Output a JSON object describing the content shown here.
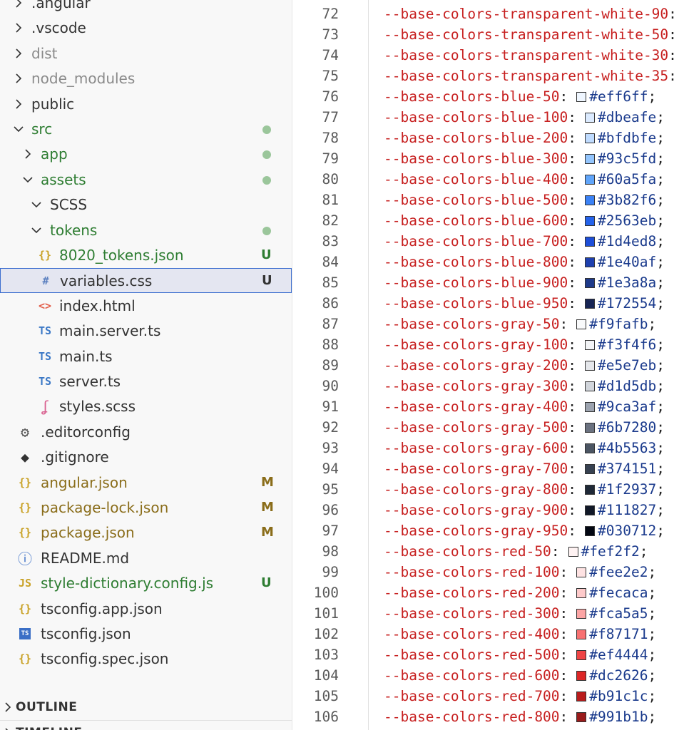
{
  "explorer": {
    "items": [
      {
        "label": ".angular",
        "type": "folder",
        "depth": 0,
        "state": "collapsed",
        "icon": "chevron-right-icon",
        "color": "#333333"
      },
      {
        "label": ".vscode",
        "type": "folder",
        "depth": 0,
        "state": "collapsed",
        "icon": "chevron-right-icon",
        "color": "#333333"
      },
      {
        "label": "dist",
        "type": "folder",
        "depth": 0,
        "state": "collapsed",
        "icon": "chevron-right-icon",
        "color": "#8a8a8a"
      },
      {
        "label": "node_modules",
        "type": "folder",
        "depth": 0,
        "state": "collapsed",
        "icon": "chevron-right-icon",
        "color": "#8a8a8a"
      },
      {
        "label": "public",
        "type": "folder",
        "depth": 0,
        "state": "collapsed",
        "icon": "chevron-right-icon",
        "color": "#333333"
      },
      {
        "label": "src",
        "type": "folder",
        "depth": 0,
        "state": "expanded",
        "icon": "chevron-down-icon",
        "color": "#2e7d32",
        "dot": true
      },
      {
        "label": "app",
        "type": "folder",
        "depth": 1,
        "state": "collapsed",
        "icon": "chevron-right-icon",
        "color": "#2e7d32",
        "dot": true
      },
      {
        "label": "assets",
        "type": "folder",
        "depth": 1,
        "state": "expanded",
        "icon": "chevron-down-icon",
        "color": "#2e7d32",
        "dot": true
      },
      {
        "label": "SCSS",
        "type": "folder",
        "depth": 2,
        "state": "expanded",
        "icon": "chevron-down-icon",
        "color": "#333333"
      },
      {
        "label": "tokens",
        "type": "folder",
        "depth": 2,
        "state": "expanded",
        "icon": "chevron-down-icon",
        "color": "#2e7d32",
        "dot": true
      },
      {
        "label": "8020_tokens.json",
        "type": "file",
        "depth": 3,
        "icon": "json-braces-icon",
        "glyph": "{}",
        "glyph_color": "#c9a227",
        "color": "#2e7d32",
        "badge": "U",
        "badge_color": "#2e7d32"
      },
      {
        "label": "variables.css",
        "type": "file",
        "depth": 3,
        "icon": "css-hash-icon",
        "glyph": "#",
        "glyph_color": "#5a7fbf",
        "color": "#333333",
        "badge": "U",
        "badge_color": "#333333",
        "selected": true
      },
      {
        "label": "index.html",
        "type": "file",
        "depth": 2,
        "icon": "html-icon",
        "glyph": "<>",
        "glyph_color": "#e3604c",
        "color": "#333333"
      },
      {
        "label": "main.server.ts",
        "type": "file",
        "depth": 2,
        "icon": "typescript-icon",
        "glyph": "TS",
        "glyph_color": "#3b78c6",
        "color": "#333333"
      },
      {
        "label": "main.ts",
        "type": "file",
        "depth": 2,
        "icon": "typescript-icon",
        "glyph": "TS",
        "glyph_color": "#3b78c6",
        "color": "#333333"
      },
      {
        "label": "server.ts",
        "type": "file",
        "depth": 2,
        "icon": "typescript-icon",
        "glyph": "TS",
        "glyph_color": "#3b78c6",
        "color": "#333333"
      },
      {
        "label": "styles.scss",
        "type": "file",
        "depth": 2,
        "icon": "sass-icon",
        "glyph": "ʆ",
        "glyph_color": "#d9608f",
        "color": "#333333"
      },
      {
        "label": ".editorconfig",
        "type": "file",
        "depth": 1,
        "icon": "gear-icon",
        "glyph": "⚙",
        "glyph_color": "#555555",
        "color": "#333333"
      },
      {
        "label": ".gitignore",
        "type": "file",
        "depth": 1,
        "icon": "git-icon",
        "glyph": "◆",
        "glyph_color": "#333333",
        "color": "#333333"
      },
      {
        "label": "angular.json",
        "type": "file",
        "depth": 1,
        "icon": "json-braces-icon",
        "glyph": "{}",
        "glyph_color": "#c9a227",
        "color": "#8a6d1a",
        "badge": "M",
        "badge_color": "#8a6d1a"
      },
      {
        "label": "package-lock.json",
        "type": "file",
        "depth": 1,
        "icon": "json-braces-icon",
        "glyph": "{}",
        "glyph_color": "#c9a227",
        "color": "#8a6d1a",
        "badge": "M",
        "badge_color": "#8a6d1a"
      },
      {
        "label": "package.json",
        "type": "file",
        "depth": 1,
        "icon": "json-braces-icon",
        "glyph": "{}",
        "glyph_color": "#c9a227",
        "color": "#8a6d1a",
        "badge": "M",
        "badge_color": "#8a6d1a"
      },
      {
        "label": "README.md",
        "type": "file",
        "depth": 1,
        "icon": "info-icon",
        "glyph": "ⓘ",
        "glyph_color": "#3b6fc6",
        "color": "#333333"
      },
      {
        "label": "style-dictionary.config.js",
        "type": "file",
        "depth": 1,
        "icon": "javascript-icon",
        "glyph": "JS",
        "glyph_color": "#c9a227",
        "color": "#2e7d32",
        "badge": "U",
        "badge_color": "#2e7d32"
      },
      {
        "label": "tsconfig.app.json",
        "type": "file",
        "depth": 1,
        "icon": "json-braces-icon",
        "glyph": "{}",
        "glyph_color": "#c9a227",
        "color": "#333333"
      },
      {
        "label": "tsconfig.json",
        "type": "file",
        "depth": 1,
        "icon": "tsconfig-icon",
        "glyph": "TS",
        "glyph_color": "#ffffff",
        "color": "#333333"
      },
      {
        "label": "tsconfig.spec.json",
        "type": "file",
        "depth": 1,
        "icon": "json-braces-icon",
        "glyph": "{}",
        "glyph_color": "#c9a227",
        "color": "#333333"
      }
    ]
  },
  "panels": {
    "outline": "OUTLINE",
    "timeline": "TIMELINE"
  },
  "editor": {
    "lines": [
      {
        "num": "72",
        "prop": "--base-colors-transparent-white-90",
        "value": "",
        "swatch": null
      },
      {
        "num": "73",
        "prop": "--base-colors-transparent-white-50",
        "value": "",
        "swatch": null
      },
      {
        "num": "74",
        "prop": "--base-colors-transparent-white-30",
        "value": "",
        "swatch": null
      },
      {
        "num": "75",
        "prop": "--base-colors-transparent-white-35",
        "value": "",
        "swatch": null
      },
      {
        "num": "76",
        "prop": "--base-colors-blue-50",
        "value": "#eff6ff",
        "swatch": "#eff6ff"
      },
      {
        "num": "77",
        "prop": "--base-colors-blue-100",
        "value": "#dbeafe",
        "swatch": "#dbeafe"
      },
      {
        "num": "78",
        "prop": "--base-colors-blue-200",
        "value": "#bfdbfe",
        "swatch": "#bfdbfe"
      },
      {
        "num": "79",
        "prop": "--base-colors-blue-300",
        "value": "#93c5fd",
        "swatch": "#93c5fd"
      },
      {
        "num": "80",
        "prop": "--base-colors-blue-400",
        "value": "#60a5fa",
        "swatch": "#60a5fa"
      },
      {
        "num": "81",
        "prop": "--base-colors-blue-500",
        "value": "#3b82f6",
        "swatch": "#3b82f6"
      },
      {
        "num": "82",
        "prop": "--base-colors-blue-600",
        "value": "#2563eb",
        "swatch": "#2563eb"
      },
      {
        "num": "83",
        "prop": "--base-colors-blue-700",
        "value": "#1d4ed8",
        "swatch": "#1d4ed8"
      },
      {
        "num": "84",
        "prop": "--base-colors-blue-800",
        "value": "#1e40af",
        "swatch": "#1e40af"
      },
      {
        "num": "85",
        "prop": "--base-colors-blue-900",
        "value": "#1e3a8a",
        "swatch": "#1e3a8a"
      },
      {
        "num": "86",
        "prop": "--base-colors-blue-950",
        "value": "#172554",
        "swatch": "#172554"
      },
      {
        "num": "87",
        "prop": "--base-colors-gray-50",
        "value": "#f9fafb",
        "swatch": "#f9fafb"
      },
      {
        "num": "88",
        "prop": "--base-colors-gray-100",
        "value": "#f3f4f6",
        "swatch": "#f3f4f6"
      },
      {
        "num": "89",
        "prop": "--base-colors-gray-200",
        "value": "#e5e7eb",
        "swatch": "#e5e7eb"
      },
      {
        "num": "90",
        "prop": "--base-colors-gray-300",
        "value": "#d1d5db",
        "swatch": "#d1d5db"
      },
      {
        "num": "91",
        "prop": "--base-colors-gray-400",
        "value": "#9ca3af",
        "swatch": "#9ca3af"
      },
      {
        "num": "92",
        "prop": "--base-colors-gray-500",
        "value": "#6b7280",
        "swatch": "#6b7280"
      },
      {
        "num": "93",
        "prop": "--base-colors-gray-600",
        "value": "#4b5563",
        "swatch": "#4b5563"
      },
      {
        "num": "94",
        "prop": "--base-colors-gray-700",
        "value": "#374151",
        "swatch": "#374151"
      },
      {
        "num": "95",
        "prop": "--base-colors-gray-800",
        "value": "#1f2937",
        "swatch": "#1f2937"
      },
      {
        "num": "96",
        "prop": "--base-colors-gray-900",
        "value": "#111827",
        "swatch": "#111827"
      },
      {
        "num": "97",
        "prop": "--base-colors-gray-950",
        "value": "#030712",
        "swatch": "#030712"
      },
      {
        "num": "98",
        "prop": "--base-colors-red-50",
        "value": "#fef2f2",
        "swatch": "#fef2f2"
      },
      {
        "num": "99",
        "prop": "--base-colors-red-100",
        "value": "#fee2e2",
        "swatch": "#fee2e2"
      },
      {
        "num": "100",
        "prop": "--base-colors-red-200",
        "value": "#fecaca",
        "swatch": "#fecaca"
      },
      {
        "num": "101",
        "prop": "--base-colors-red-300",
        "value": "#fca5a5",
        "swatch": "#fca5a5"
      },
      {
        "num": "102",
        "prop": "--base-colors-red-400",
        "value": "#f87171",
        "swatch": "#f87171"
      },
      {
        "num": "103",
        "prop": "--base-colors-red-500",
        "value": "#ef4444",
        "swatch": "#ef4444"
      },
      {
        "num": "104",
        "prop": "--base-colors-red-600",
        "value": "#dc2626",
        "swatch": "#dc2626"
      },
      {
        "num": "105",
        "prop": "--base-colors-red-700",
        "value": "#b91c1c",
        "swatch": "#b91c1c"
      },
      {
        "num": "106",
        "prop": "--base-colors-red-800",
        "value": "#991b1b",
        "swatch": "#991b1b"
      }
    ]
  }
}
